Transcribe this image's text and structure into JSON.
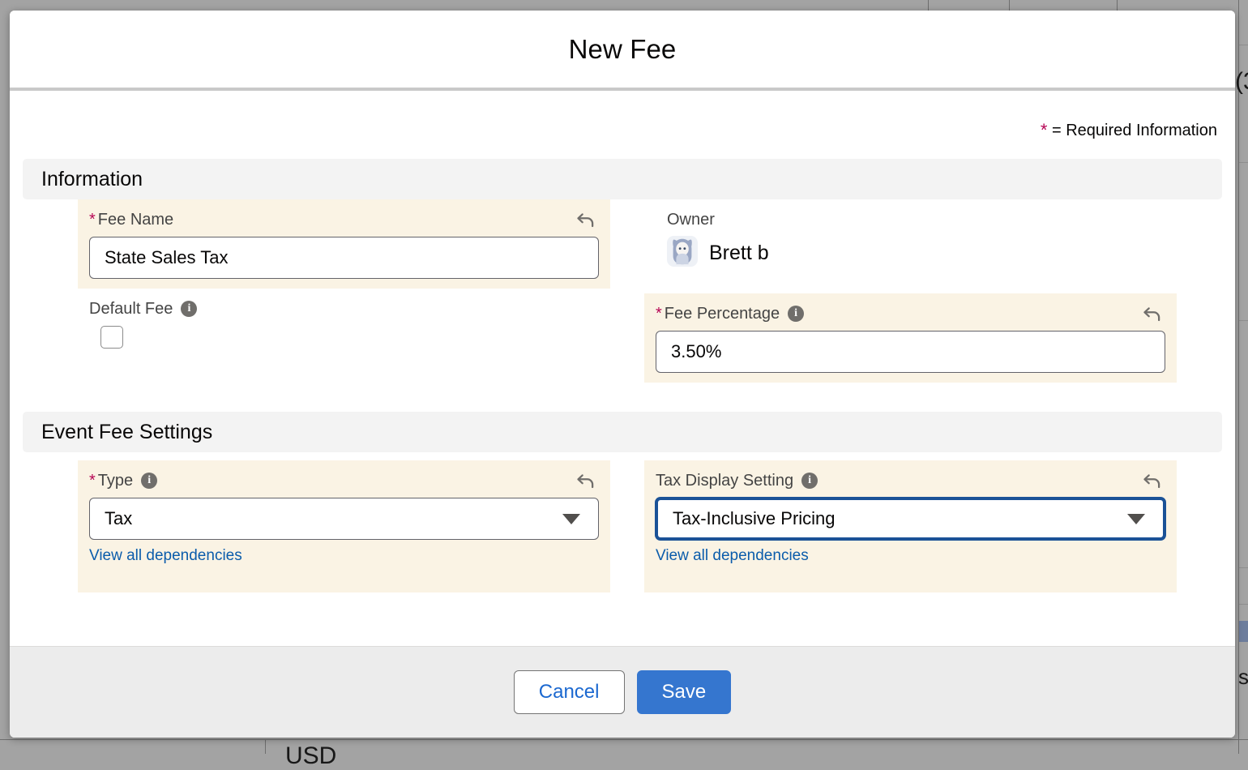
{
  "modal": {
    "title": "New Fee",
    "required_legend": "= Required Information",
    "required_star": "*"
  },
  "sections": {
    "information": {
      "title": "Information",
      "fee_name": {
        "label": "Fee Name",
        "required": "*",
        "value": "State Sales Tax",
        "undo_icon": "undo-arrow-icon"
      },
      "default_fee": {
        "label": "Default Fee",
        "info_icon": "info-icon",
        "checked": false
      },
      "owner": {
        "label": "Owner",
        "name": "Brett b",
        "avatar_icon": "user-avatar-icon"
      },
      "fee_percentage": {
        "label": "Fee Percentage",
        "required": "*",
        "info_icon": "info-icon",
        "value": "3.50%",
        "undo_icon": "undo-arrow-icon"
      }
    },
    "event_fee_settings": {
      "title": "Event Fee Settings",
      "type": {
        "label": "Type",
        "required": "*",
        "info_icon": "info-icon",
        "value": "Tax",
        "dependencies_link": "View all dependencies",
        "undo_icon": "undo-arrow-icon",
        "caret_icon": "caret-down-icon"
      },
      "tax_display_setting": {
        "label": "Tax Display Setting",
        "info_icon": "info-icon",
        "value": "Tax-Inclusive Pricing",
        "dependencies_link": "View all dependencies",
        "undo_icon": "undo-arrow-icon",
        "caret_icon": "caret-down-icon",
        "focused": true
      }
    }
  },
  "footer": {
    "cancel_label": "Cancel",
    "save_label": "Save"
  },
  "background": {
    "partial_text_right": "(3",
    "partial_text_bottom": "USD",
    "partial_text_right_lower": "s"
  },
  "colors": {
    "accent_blue": "#3576cf",
    "link_blue": "#0b5cab",
    "required_red": "#b60554",
    "edited_bg": "#faf3e4",
    "section_bg": "#f3f3f3",
    "focus_border": "#1b5297",
    "backdrop_grey": "#a3a3a3"
  }
}
